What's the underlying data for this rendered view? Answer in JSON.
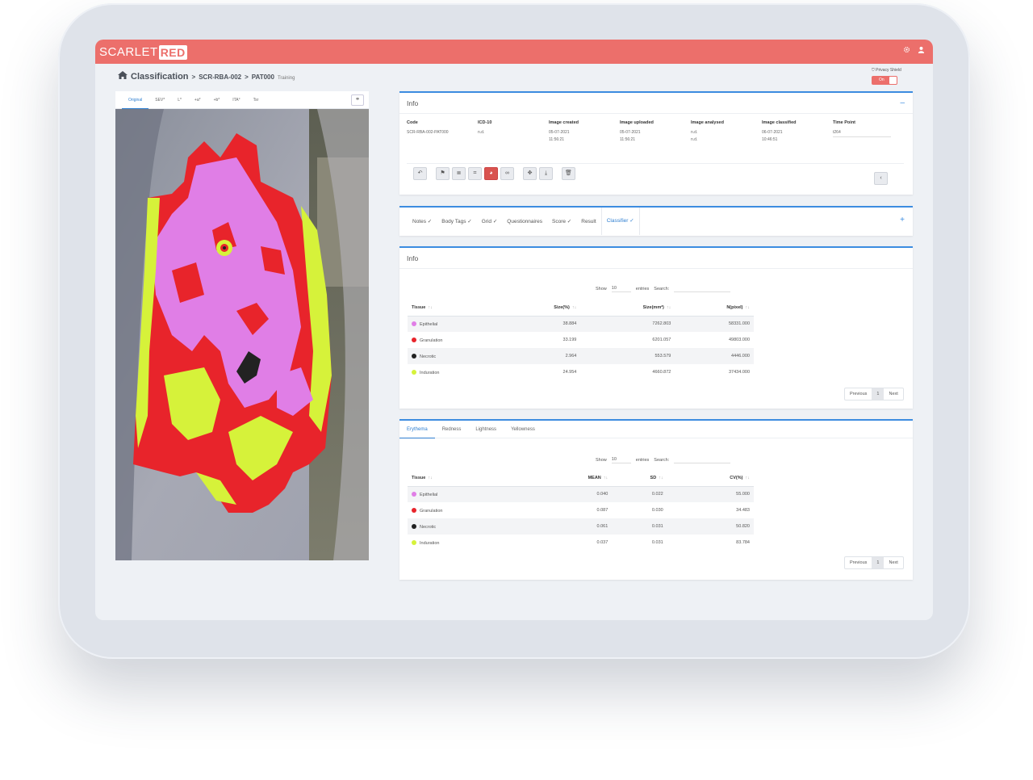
{
  "brand": {
    "name_a": "SCARLET",
    "name_b": "RED"
  },
  "header": {
    "settings_icon": "gear-icon",
    "user_icon": "user-icon"
  },
  "breadcrumb": {
    "title": "Classification",
    "sep1": ">",
    "patient": "SCR-RBA-002",
    "sep2": ">",
    "case": "PAT000",
    "tag": "Training"
  },
  "privacy": {
    "label": "Privacy Shield",
    "toggle": "On"
  },
  "image_panel": {
    "tabs": [
      "Original",
      "SEV*",
      "L*",
      "+a*",
      "+b*",
      "ITA°",
      "Tsr"
    ],
    "active_tab": "Original"
  },
  "info": {
    "title": "Info",
    "collapse": "–",
    "columns": [
      {
        "label": "Code",
        "lines": [
          "SCR-RBA-002-PAT000"
        ]
      },
      {
        "label": "ICD-10",
        "lines": [
          "n.d."
        ]
      },
      {
        "label": "Image created",
        "lines": [
          "05-07-2021",
          "11:56:21"
        ]
      },
      {
        "label": "Image uploaded",
        "lines": [
          "05-07-2021",
          "11:56:21"
        ]
      },
      {
        "label": "Image analysed",
        "lines": [
          "n.d.",
          "n.d."
        ]
      },
      {
        "label": "Image classified",
        "lines": [
          "06-07-2021",
          "10:46:51"
        ]
      },
      {
        "label": "Time Point",
        "lines": [
          "t264"
        ]
      }
    ]
  },
  "toolbar": {
    "buttons": [
      "undo-icon",
      "flag-icon",
      "list-icon",
      "crop-icon",
      "classifier-icon",
      "link-icon",
      "move-icon",
      "download-icon",
      "trash-icon"
    ],
    "back": "‹"
  },
  "nav_tabs": {
    "items": [
      "Notes ✓",
      "Body Tags ✓",
      "Grid ✓",
      "Questionnaires",
      "Score ✓",
      "Result",
      "Classifier ✓"
    ],
    "active": "Classifier ✓",
    "add": "+"
  },
  "table1": {
    "title": "Info",
    "show": "Show",
    "entries_value": "10",
    "entries": "entries",
    "search": "Search:",
    "headers": [
      "Tissue",
      "Size(%)",
      "Size(mm²)",
      "N(pixel)"
    ],
    "rows": [
      {
        "tissue": "Epithelial",
        "color": "#e07ee6",
        "a": "38.884",
        "b": "7262.803",
        "c": "58331.000"
      },
      {
        "tissue": "Granulation",
        "color": "#e8242b",
        "a": "33.199",
        "b": "6201.057",
        "c": "49803.000"
      },
      {
        "tissue": "Necrotic",
        "color": "#222222",
        "a": "2.964",
        "b": "553.579",
        "c": "4446.000"
      },
      {
        "tissue": "Induration",
        "color": "#d6f23a",
        "a": "24.954",
        "b": "4660.872",
        "c": "37434.000"
      }
    ],
    "prev": "Previous",
    "page": "1",
    "next": "Next"
  },
  "table2": {
    "tabs": [
      "Erythema",
      "Redness",
      "Lightness",
      "Yellowness"
    ],
    "active": "Erythema",
    "show": "Show",
    "entries_value": "10",
    "entries": "entries",
    "search": "Search:",
    "headers": [
      "Tissue",
      "MEAN",
      "SD",
      "CV(%)"
    ],
    "rows": [
      {
        "tissue": "Epithelial",
        "color": "#e07ee6",
        "a": "0.040",
        "b": "0.022",
        "c": "55.000"
      },
      {
        "tissue": "Granulation",
        "color": "#e8242b",
        "a": "0.087",
        "b": "0.030",
        "c": "34.483"
      },
      {
        "tissue": "Necrotic",
        "color": "#222222",
        "a": "0.061",
        "b": "0.031",
        "c": "50.820"
      },
      {
        "tissue": "Induration",
        "color": "#d6f23a",
        "a": "0.037",
        "b": "0.031",
        "c": "83.784"
      }
    ],
    "prev": "Previous",
    "page": "1",
    "next": "Next"
  },
  "colors": {
    "brand": "#ec6f6b",
    "accent": "#3c8ce0",
    "active_tool": "#d9534f"
  }
}
